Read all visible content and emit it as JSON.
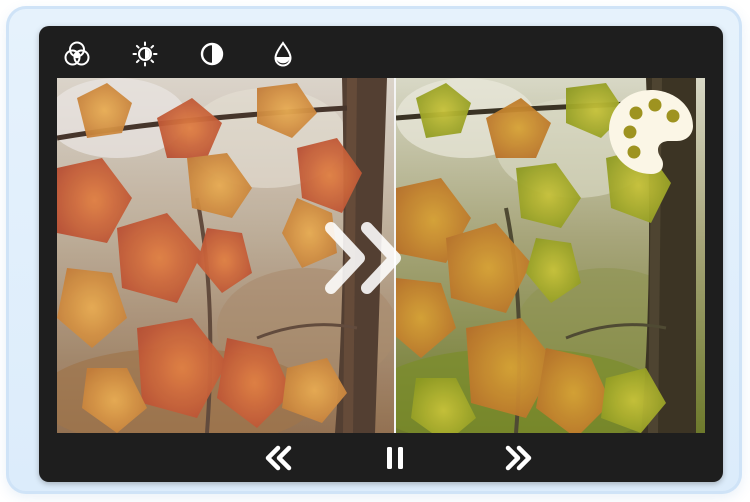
{
  "toolbar": {
    "tools": [
      {
        "icon": "color-channels-icon"
      },
      {
        "icon": "brightness-icon"
      },
      {
        "icon": "contrast-icon"
      },
      {
        "icon": "saturation-drop-icon"
      }
    ]
  },
  "viewer": {
    "left_image": "autumn-maple-leaves-original",
    "right_image": "autumn-maple-leaves-color-graded",
    "compare_icon": "double-chevron-right-icon",
    "badge_icon": "palette-icon"
  },
  "playback": {
    "buttons": [
      {
        "icon": "rewind-icon"
      },
      {
        "icon": "pause-icon"
      },
      {
        "icon": "fast-forward-icon"
      }
    ]
  },
  "colors": {
    "frame_bg": "#1e1e1e",
    "outer_bg": "#e3f0fc",
    "icon": "#ffffff",
    "left_leaf_tone": "#c8582c",
    "right_leaf_tone": "#b7a628"
  }
}
